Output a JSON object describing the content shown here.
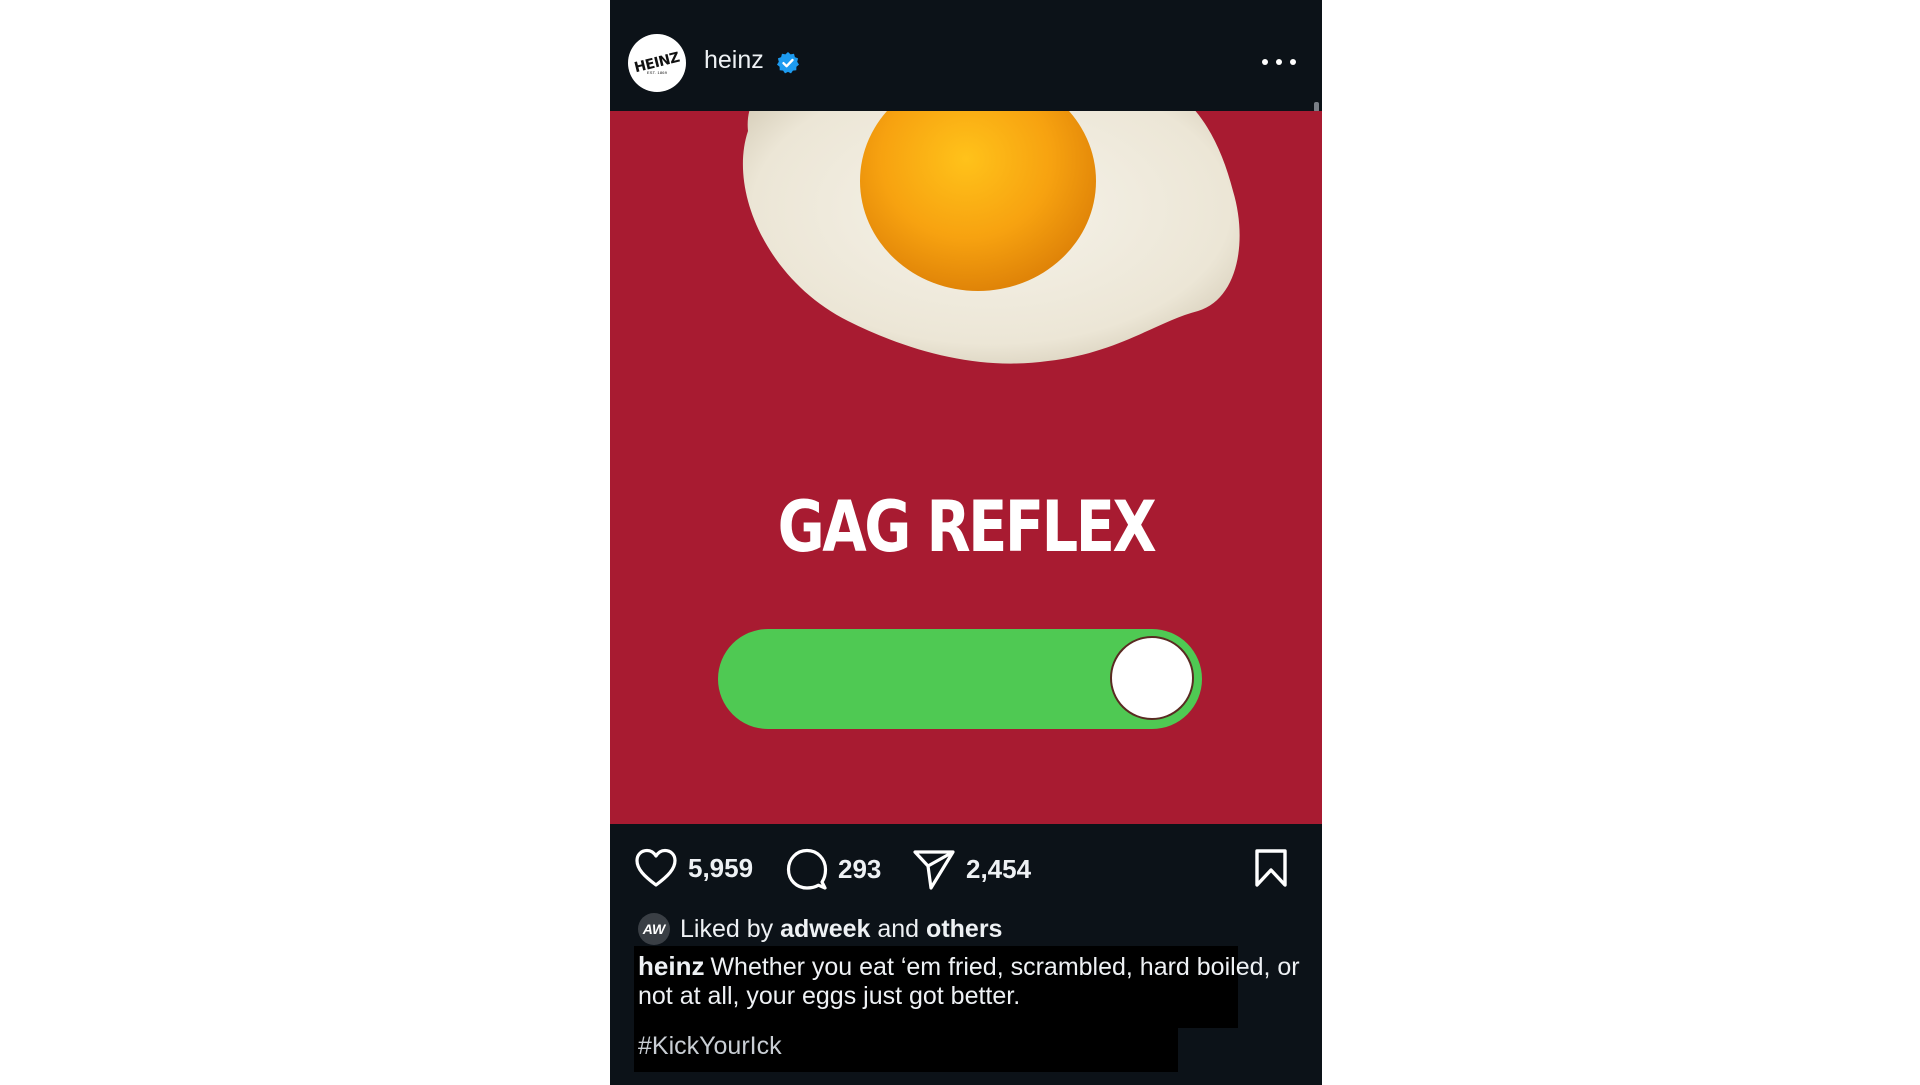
{
  "post": {
    "username": "heinz",
    "avatar_text": "HEINZ",
    "avatar_subtext": "EST. 1869",
    "verified_icon": "verified-badge-icon",
    "more_icon": "more-options-icon"
  },
  "media": {
    "headline": "GAG REFLEX",
    "toggle_state": "on",
    "toggle_color": "#4fc953",
    "background_color": "#a81b31"
  },
  "actions": {
    "likes": "5,959",
    "comments": "293",
    "shares": "2,454"
  },
  "liked_by": {
    "prefix": "Liked by",
    "user": "adweek",
    "connector": "and",
    "others": "others",
    "avatar_text": "AW"
  },
  "caption": {
    "user": "heinz",
    "text": "Whether you eat ‘em fried, scrambled, hard boiled, or not at all, your eggs just got better.",
    "hashtag": "#KickYourIck"
  }
}
